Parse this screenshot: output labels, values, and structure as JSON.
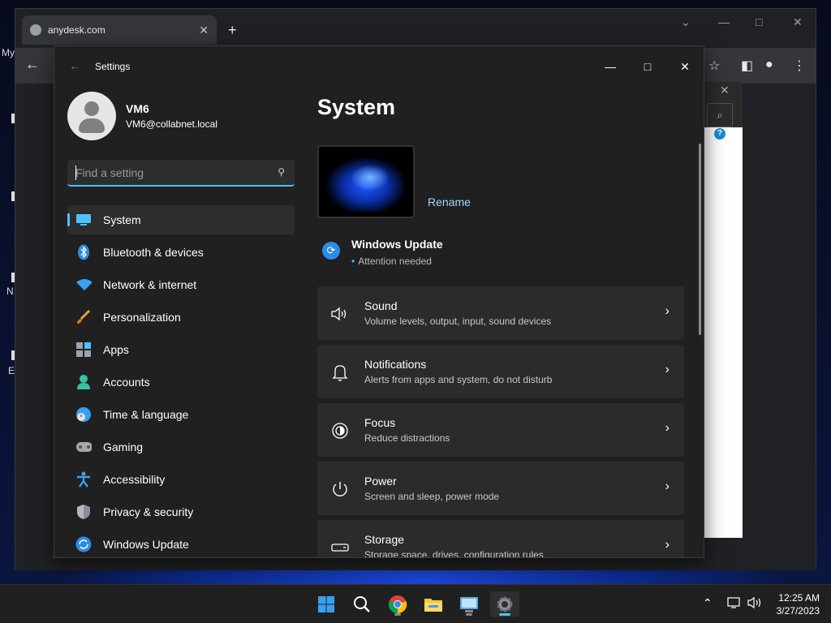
{
  "desktop": {
    "left_labels": [
      "My",
      "N",
      "E"
    ]
  },
  "browser": {
    "tab_title": "anydesk.com",
    "tab_close": "✕",
    "new_tab": "+",
    "help_badge": "?"
  },
  "settings": {
    "window_title": "Settings",
    "user": {
      "name": "VM6",
      "email": "VM6@collabnet.local"
    },
    "search_placeholder": "Find a setting",
    "nav": [
      {
        "label": "System",
        "icon": "monitor-icon"
      },
      {
        "label": "Bluetooth & devices",
        "icon": "bluetooth-icon"
      },
      {
        "label": "Network & internet",
        "icon": "wifi-icon"
      },
      {
        "label": "Personalization",
        "icon": "brush-icon"
      },
      {
        "label": "Apps",
        "icon": "apps-icon"
      },
      {
        "label": "Accounts",
        "icon": "person-icon"
      },
      {
        "label": "Time & language",
        "icon": "globe-clock-icon"
      },
      {
        "label": "Gaming",
        "icon": "gamepad-icon"
      },
      {
        "label": "Accessibility",
        "icon": "accessibility-icon"
      },
      {
        "label": "Privacy & security",
        "icon": "shield-icon"
      },
      {
        "label": "Windows Update",
        "icon": "update-icon"
      }
    ],
    "page_title": "System",
    "rename_label": "Rename",
    "windows_update": {
      "title": "Windows Update",
      "status": "Attention needed"
    },
    "cards": [
      {
        "title": "Sound",
        "subtitle": "Volume levels, output, input, sound devices",
        "icon": "speaker-icon"
      },
      {
        "title": "Notifications",
        "subtitle": "Alerts from apps and system, do not disturb",
        "icon": "bell-icon"
      },
      {
        "title": "Focus",
        "subtitle": "Reduce distractions",
        "icon": "focus-icon"
      },
      {
        "title": "Power",
        "subtitle": "Screen and sleep, power mode",
        "icon": "power-icon"
      },
      {
        "title": "Storage",
        "subtitle": "Storage space, drives, configuration rules",
        "icon": "storage-icon"
      }
    ]
  },
  "taskbar": {
    "time": "12:25 AM",
    "date": "3/27/2023"
  },
  "colors": {
    "accent": "#4cc2ff",
    "window_bg": "#202020",
    "card_bg": "#2b2b2b"
  }
}
